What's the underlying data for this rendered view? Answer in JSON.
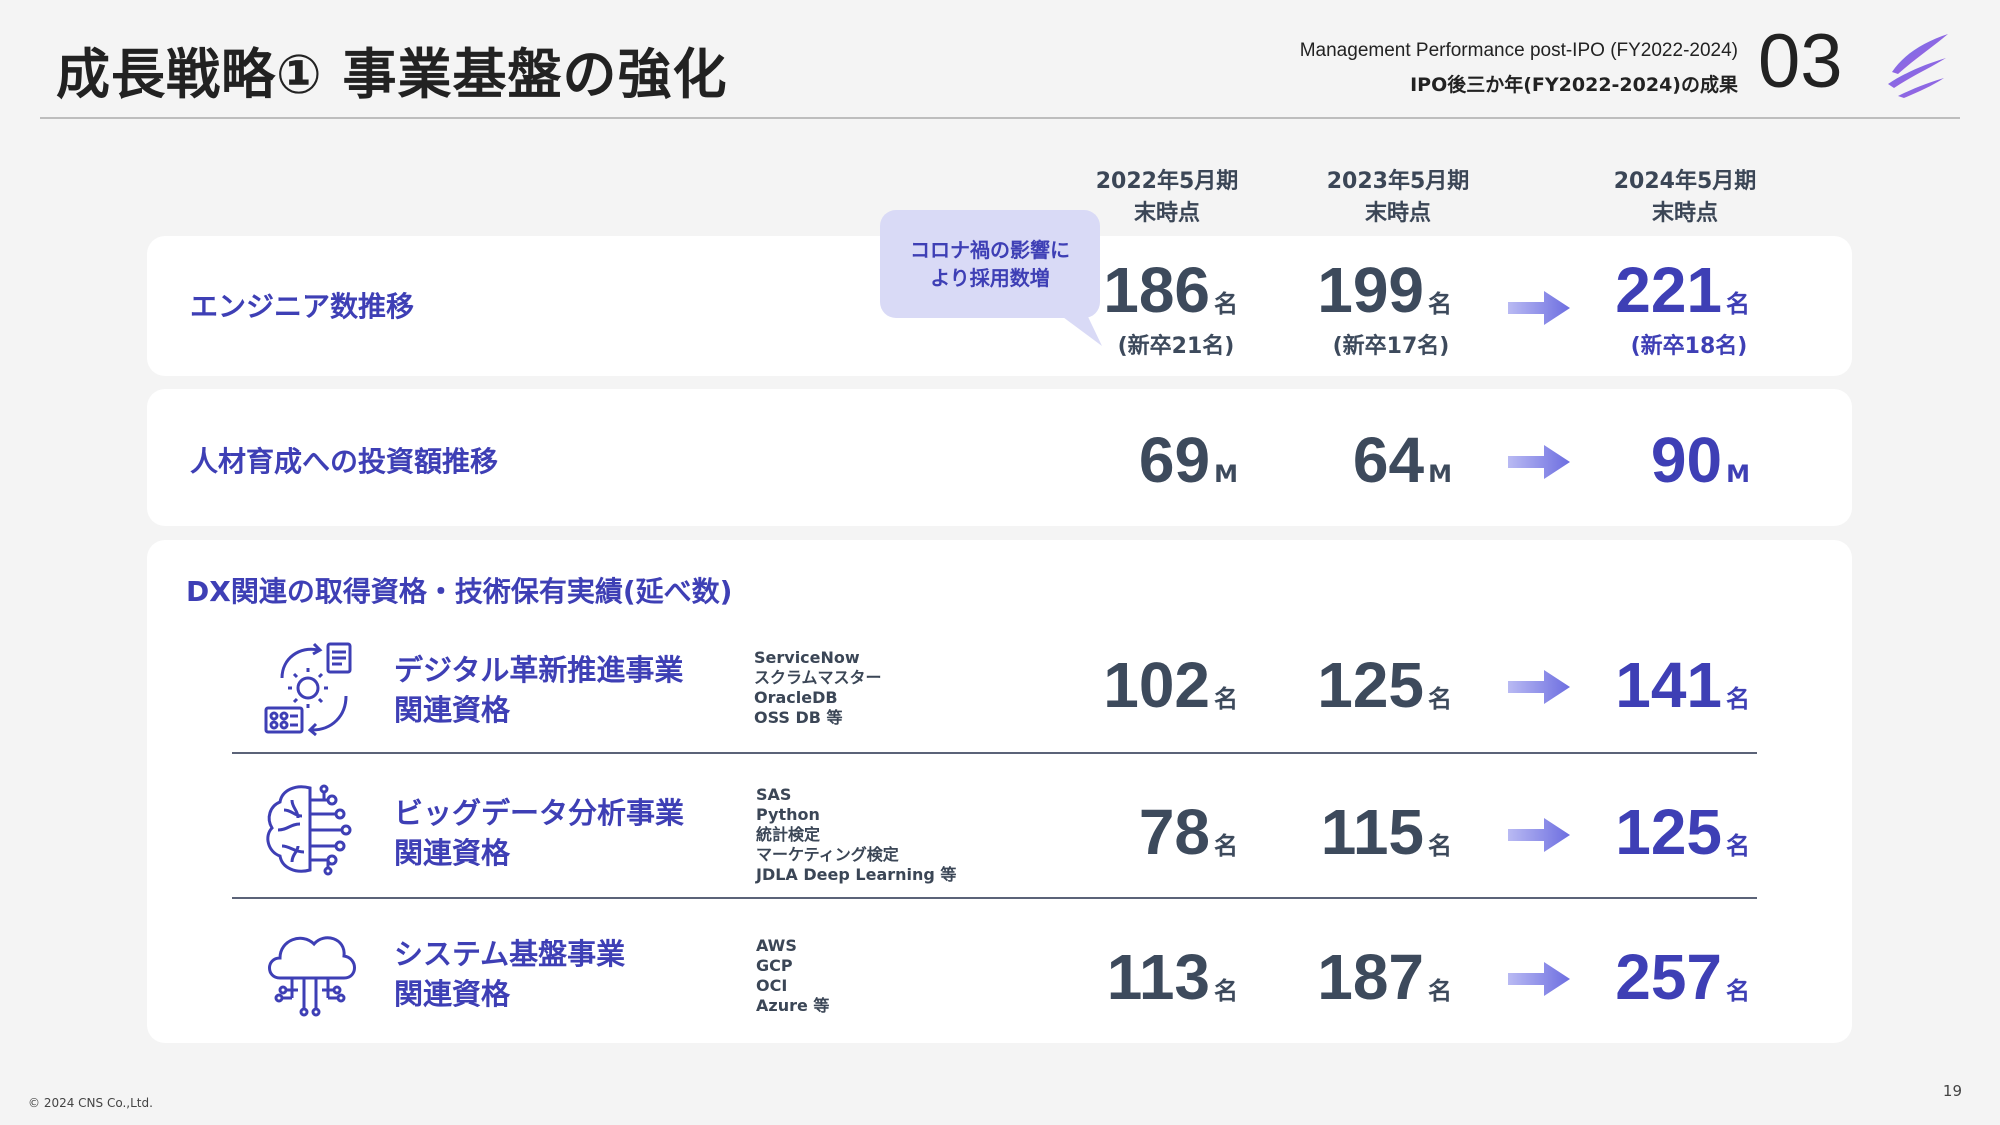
{
  "header": {
    "title": "成長戦略① 事業基盤の強化",
    "subtitle_en": "Management Performance post-IPO (FY2022-2024)",
    "subtitle_jp": "IPO後三か年(FY2022-2024)の成果",
    "section_number": "03"
  },
  "columns": [
    {
      "line1": "2022年5月期",
      "line2": "末時点"
    },
    {
      "line1": "2023年5月期",
      "line2": "末時点"
    },
    {
      "line1": "2024年5月期",
      "line2": "末時点"
    }
  ],
  "callout": {
    "line1": "コロナ禍の影響に",
    "line2": "より採用数増"
  },
  "engineers": {
    "label": "エンジニア数推移",
    "values": [
      "186",
      "199",
      "221"
    ],
    "unit": "名",
    "new_grads": [
      "(新卒21名)",
      "(新卒17名)",
      "(新卒18名)"
    ]
  },
  "investment": {
    "label": "人材育成への投資額推移",
    "values": [
      "69",
      "64",
      "90"
    ],
    "unit": "M"
  },
  "certifications": {
    "title": "DX関連の取得資格・技術保有実績(延べ数)",
    "unit": "名",
    "rows": [
      {
        "label1": "デジタル革新推進事業",
        "label2": "関連資格",
        "quals": [
          "ServiceNow",
          "スクラムマスター",
          "OracleDB",
          "OSS DB 等"
        ],
        "values": [
          "102",
          "125",
          "141"
        ]
      },
      {
        "label1": "ビッグデータ分析事業",
        "label2": "関連資格",
        "quals": [
          "SAS",
          "Python",
          "統計検定",
          "マーケティング検定",
          "JDLA  Deep Learning 等"
        ],
        "values": [
          "78",
          "115",
          "125"
        ]
      },
      {
        "label1": "システム基盤事業",
        "label2": "関連資格",
        "quals": [
          "AWS",
          "GCP",
          "OCI",
          "Azure 等"
        ],
        "values": [
          "113",
          "187",
          "257"
        ]
      }
    ]
  },
  "footer": {
    "copyright": "© 2024 CNS Co.,Ltd.",
    "page": "19"
  },
  "colors": {
    "accent": "#3e3fb5",
    "value_grey": "#3d4a5c",
    "bubble": "#d9daf6",
    "arrow": "#7f80e6"
  },
  "icons": [
    "digital-transformation-icon",
    "brain-circuit-icon",
    "cloud-network-icon",
    "arrow-right-icon",
    "brand-logo-icon"
  ]
}
